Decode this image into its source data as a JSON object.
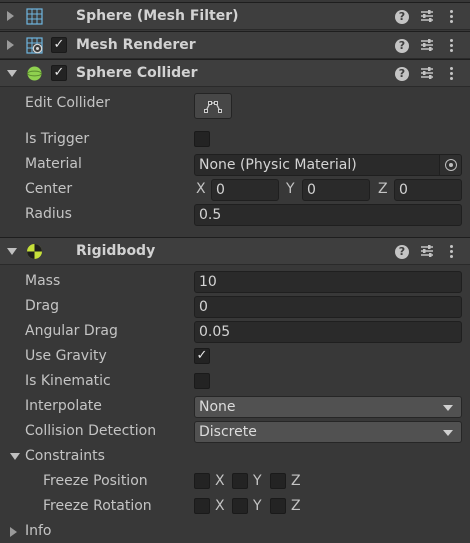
{
  "components": {
    "mesh_filter": {
      "title": "Sphere (Mesh Filter)",
      "help": "?"
    },
    "mesh_renderer": {
      "title": "Mesh Renderer",
      "enabled": "✓",
      "help": "?"
    },
    "sphere_collider": {
      "title": "Sphere Collider",
      "enabled": "✓",
      "help": "?",
      "edit_collider_label": "Edit Collider",
      "is_trigger_label": "Is Trigger",
      "material_label": "Material",
      "material_value": "None (Physic Material)",
      "center_label": "Center",
      "center": {
        "x_label": "X",
        "x": "0",
        "y_label": "Y",
        "y": "0",
        "z_label": "Z",
        "z": "0"
      },
      "radius_label": "Radius",
      "radius": "0.5"
    },
    "rigidbody": {
      "title": "Rigidbody",
      "help": "?",
      "mass_label": "Mass",
      "mass": "10",
      "drag_label": "Drag",
      "drag": "0",
      "angular_drag_label": "Angular Drag",
      "angular_drag": "0.05",
      "use_gravity_label": "Use Gravity",
      "use_gravity": "✓",
      "is_kinematic_label": "Is Kinematic",
      "interpolate_label": "Interpolate",
      "interpolate": "None",
      "collision_detection_label": "Collision Detection",
      "collision_detection": "Discrete",
      "constraints_label": "Constraints",
      "freeze_position_label": "Freeze Position",
      "freeze_rotation_label": "Freeze Rotation",
      "axis_labels": {
        "x": "X",
        "y": "Y",
        "z": "Z"
      },
      "info_label": "Info"
    }
  },
  "colors": {
    "panel": "#383838",
    "header": "#3e3e3e",
    "field": "#2a2a2a",
    "collider_green": "#8fd14f",
    "rigidbody_yellow": "#c6e03a"
  }
}
